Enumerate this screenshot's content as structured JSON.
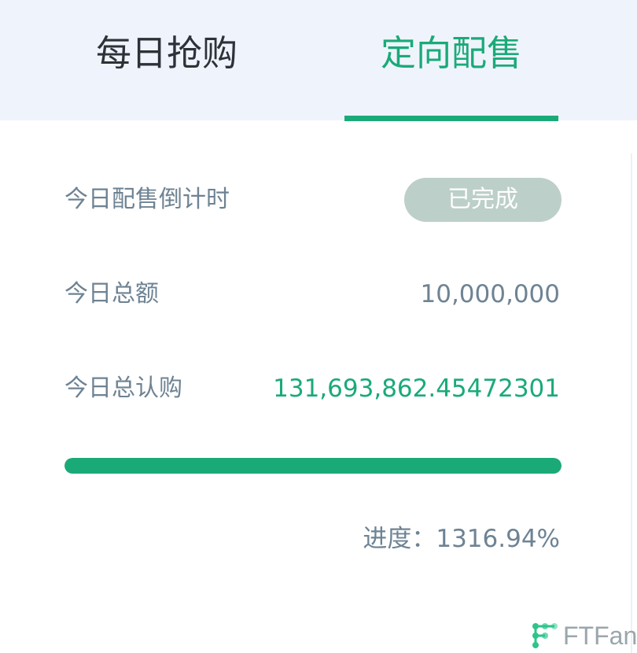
{
  "tabs": [
    {
      "label": "每日抢购",
      "active": false
    },
    {
      "label": "定向配售",
      "active": true
    }
  ],
  "colors": {
    "accent": "#1aaa78",
    "label_gray": "#6e8393",
    "pill_bg": "#bccfc8",
    "tab_bg": "#eff4fc"
  },
  "countdown": {
    "label": "今日配售倒计时",
    "status": "已完成"
  },
  "total_amount": {
    "label": "今日总额",
    "value": "10,000,000"
  },
  "total_subscribed": {
    "label": "今日总认购",
    "value": "131,693,862.45472301"
  },
  "progress": {
    "prefix": "进度：",
    "value_text": "1316.94%",
    "fill_fraction": 1.0
  },
  "watermark": {
    "text": "FTFan",
    "icon": "ftfan-logo-icon"
  }
}
